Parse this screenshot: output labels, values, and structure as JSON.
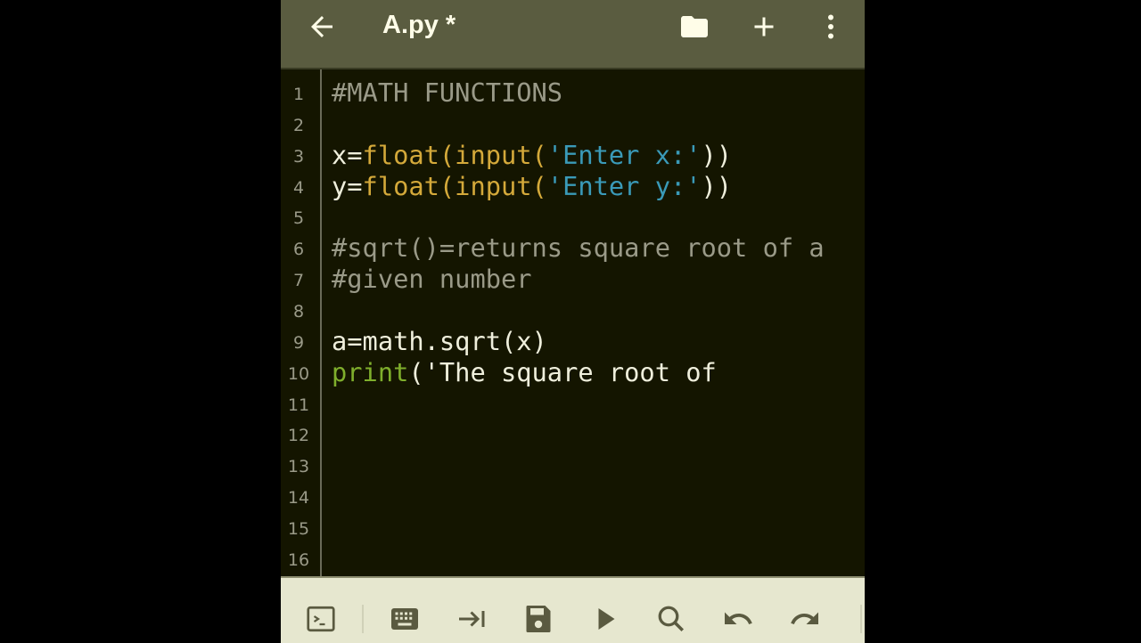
{
  "appbar": {
    "title": "A.py *"
  },
  "colors": {
    "default": "#efefdc",
    "comment": "#9a9a88",
    "builtin": "#d4a93a",
    "string": "#3a9ab8",
    "keyword": "#7fae2c"
  },
  "lines": [
    {
      "n": "1",
      "tokens": [
        {
          "t": "#MATH FUNCTIONS",
          "c": "comment"
        }
      ]
    },
    {
      "n": "2",
      "tokens": []
    },
    {
      "n": "3",
      "tokens": [
        {
          "t": "x=",
          "c": "default"
        },
        {
          "t": "float(input(",
          "c": "builtin"
        },
        {
          "t": "'Enter x:'",
          "c": "string"
        },
        {
          "t": "))",
          "c": "default"
        }
      ]
    },
    {
      "n": "4",
      "tokens": [
        {
          "t": "y=",
          "c": "default"
        },
        {
          "t": "float(input(",
          "c": "builtin"
        },
        {
          "t": "'Enter y:'",
          "c": "string"
        },
        {
          "t": "))",
          "c": "default"
        }
      ]
    },
    {
      "n": "5",
      "tokens": []
    },
    {
      "n": "6",
      "tokens": [
        {
          "t": "#sqrt()=returns square root of a",
          "c": "comment"
        }
      ]
    },
    {
      "n": "7",
      "tokens": [
        {
          "t": "#given number",
          "c": "comment"
        }
      ]
    },
    {
      "n": "8",
      "tokens": []
    },
    {
      "n": "9",
      "tokens": [
        {
          "t": "a=math.sqrt(x)",
          "c": "default"
        }
      ]
    },
    {
      "n": "10",
      "tokens": [
        {
          "t": "print",
          "c": "keyword"
        },
        {
          "t": "('The square root of",
          "c": "default"
        }
      ]
    },
    {
      "n": "11",
      "tokens": []
    },
    {
      "n": "12",
      "tokens": []
    },
    {
      "n": "13",
      "tokens": []
    },
    {
      "n": "14",
      "tokens": []
    },
    {
      "n": "15",
      "tokens": []
    },
    {
      "n": "16",
      "tokens": []
    }
  ]
}
